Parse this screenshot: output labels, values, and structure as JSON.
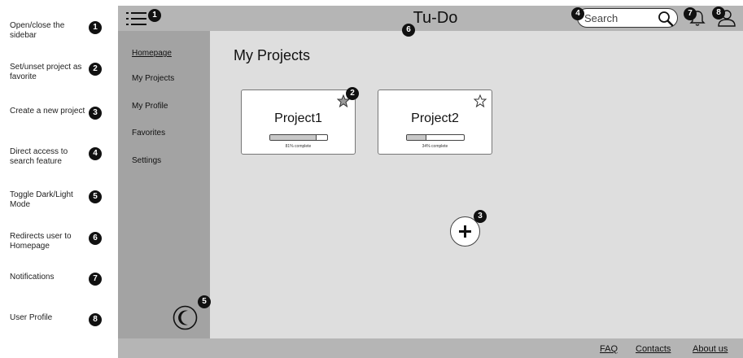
{
  "legend": [
    {
      "number": "1",
      "text": "Open/close the sidebar"
    },
    {
      "number": "2",
      "text": "Set/unset project as favorite"
    },
    {
      "number": "3",
      "text": "Create a new project"
    },
    {
      "number": "4",
      "text": "Direct access to search feature"
    },
    {
      "number": "5",
      "text": "Toggle Dark/Light Mode"
    },
    {
      "number": "6",
      "text": "Redirects user to Homepage"
    },
    {
      "number": "7",
      "text": "Notifications"
    },
    {
      "number": "8",
      "text": "User Profile"
    }
  ],
  "header": {
    "title": "Tu-Do",
    "search_placeholder": "Search",
    "icons": {
      "menu": "hamburger-menu-icon",
      "search": "search-icon",
      "notifications": "bell-icon",
      "profile": "user-icon"
    }
  },
  "sidebar": {
    "items": [
      {
        "label": "Homepage"
      },
      {
        "label": "My Projects"
      },
      {
        "label": "My Profile"
      },
      {
        "label": "Favorites"
      },
      {
        "label": "Settings"
      }
    ],
    "theme_toggle_icon": "moon-icon"
  },
  "main": {
    "heading": "My Projects",
    "projects": [
      {
        "name": "Project1",
        "progress": 0.81,
        "progress_label": "81% complete",
        "star_icon": "star-filled-icon"
      },
      {
        "name": "Project2",
        "progress": 0.34,
        "progress_label": "34% complete",
        "star_icon": "star-outline-icon"
      }
    ],
    "add_icon": "plus-icon"
  },
  "footer": {
    "links": [
      {
        "label": "FAQ"
      },
      {
        "label": "Contacts"
      },
      {
        "label": "About us"
      }
    ]
  },
  "badges": {
    "menu": "1",
    "favorite": "2",
    "add": "3",
    "search": "4",
    "theme": "5",
    "title": "6",
    "notifications": "7",
    "profile": "8"
  },
  "colors": {
    "topbar": "#b5b5b5",
    "sidebar": "#a3a3a3",
    "main": "#dedede",
    "badge": "#111111"
  }
}
